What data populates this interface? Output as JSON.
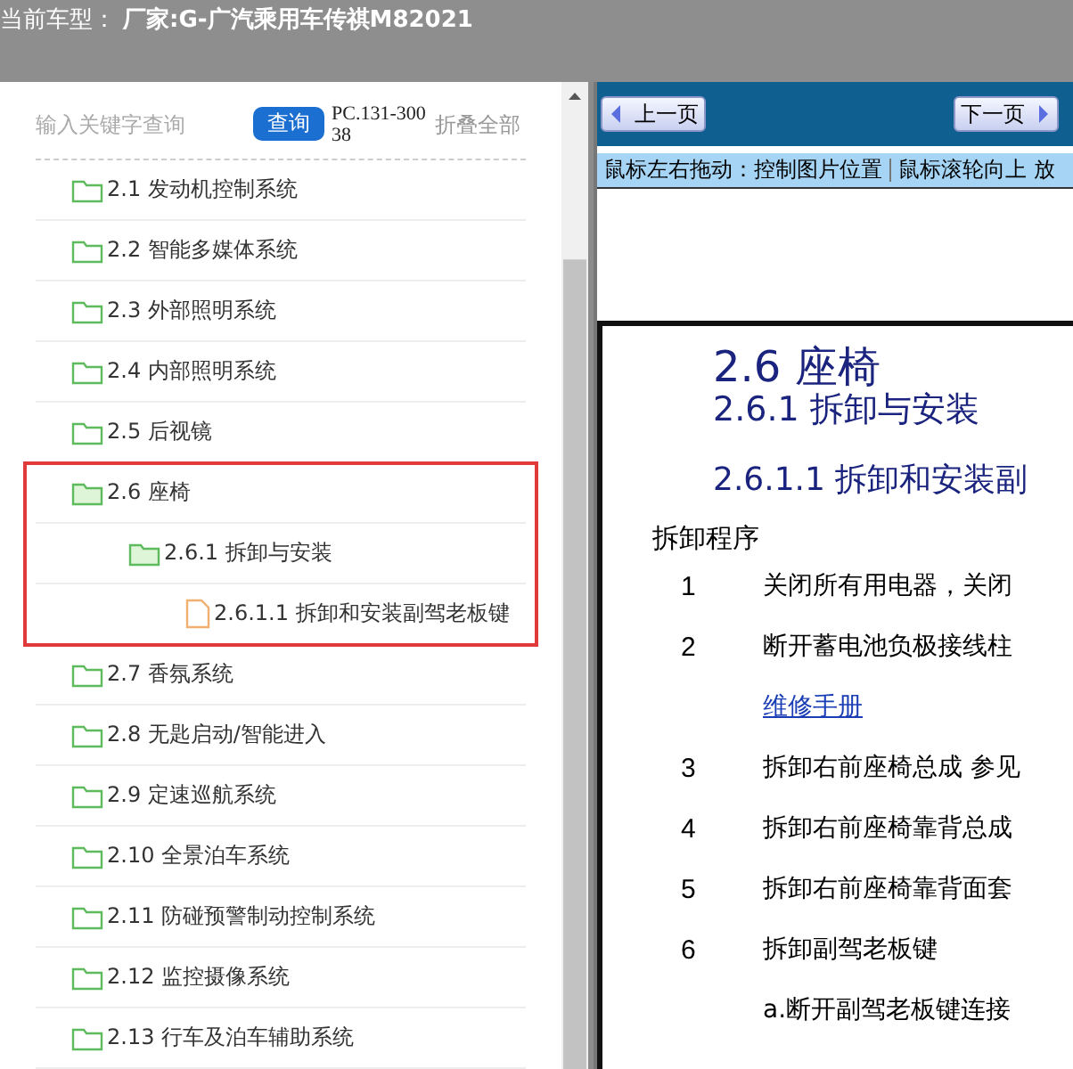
{
  "header": {
    "label": "当前车型：",
    "value": "厂家:G-广汽乘用车传祺M82021"
  },
  "search": {
    "placeholder": "输入关键字查询",
    "button": "查询",
    "code": "PC.131-30038",
    "collapse": "折叠全部"
  },
  "tree": [
    {
      "kind": "folder",
      "label": "2.1 发动机控制系统",
      "highlighted": false
    },
    {
      "kind": "folder",
      "label": "2.2 智能多媒体系统",
      "highlighted": false
    },
    {
      "kind": "folder",
      "label": "2.3 外部照明系统",
      "highlighted": false
    },
    {
      "kind": "folder",
      "label": "2.4 内部照明系统",
      "highlighted": false
    },
    {
      "kind": "folder",
      "label": "2.5 后视镜",
      "highlighted": false
    },
    {
      "kind": "folder",
      "label": "2.6 座椅",
      "highlighted": true,
      "children": [
        {
          "kind": "folder",
          "label": "2.6.1 拆卸与安装",
          "children": [
            {
              "kind": "file",
              "label": "2.6.1.1 拆卸和安装副驾老板键"
            }
          ]
        }
      ]
    },
    {
      "kind": "folder",
      "label": "2.7 香氛系统",
      "highlighted": false
    },
    {
      "kind": "folder",
      "label": "2.8 无匙启动/智能进入",
      "highlighted": false
    },
    {
      "kind": "folder",
      "label": "2.9 定速巡航系统",
      "highlighted": false
    },
    {
      "kind": "folder",
      "label": "2.10 全景泊车系统",
      "highlighted": false
    },
    {
      "kind": "folder",
      "label": "2.11 防碰预警制动控制系统",
      "highlighted": false
    },
    {
      "kind": "folder",
      "label": "2.12 监控摄像系统",
      "highlighted": false
    },
    {
      "kind": "folder",
      "label": "2.13 行车及泊车辅助系统",
      "highlighted": false
    }
  ],
  "viewer": {
    "prev": "上一页",
    "next": "下一页",
    "hints": [
      "鼠标左右拖动：控制图片位置",
      "鼠标滚轮向上 放"
    ]
  },
  "document": {
    "title": "2.6 座椅",
    "subtitle": "2.6.1 拆卸与安装",
    "section": "2.6.1.1 拆卸和安装副",
    "procedure": "拆卸程序",
    "steps": [
      {
        "kind": "step",
        "number": "1",
        "text": "关闭所有用电器，关闭"
      },
      {
        "kind": "step",
        "number": "2",
        "text": "断开蓄电池负极接线柱"
      },
      {
        "kind": "link",
        "text": "维修手册"
      },
      {
        "kind": "step",
        "number": "3",
        "text": "拆卸右前座椅总成 参见"
      },
      {
        "kind": "step",
        "number": "4",
        "text": "拆卸右前座椅靠背总成"
      },
      {
        "kind": "step",
        "number": "5",
        "text": "拆卸右前座椅靠背面套"
      },
      {
        "kind": "step",
        "number": "6",
        "text": "拆卸副驾老板键"
      },
      {
        "kind": "sub",
        "text": "a.断开副驾老板键连接"
      }
    ]
  }
}
